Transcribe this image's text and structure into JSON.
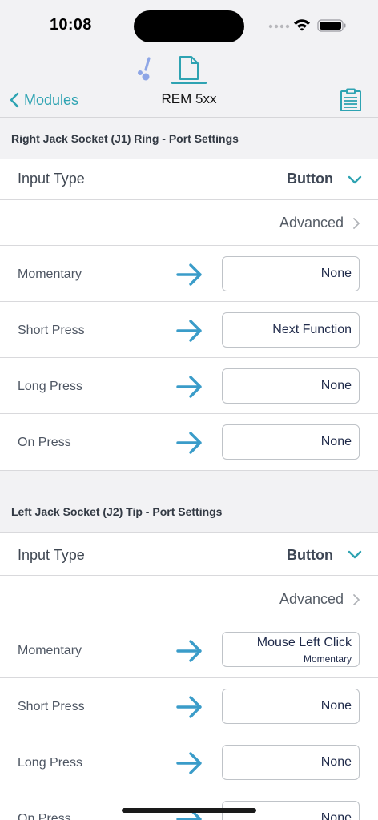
{
  "status_bar": {
    "time": "10:08"
  },
  "nav": {
    "back_label": "Modules",
    "title": "REM 5xx"
  },
  "colors": {
    "accent": "#2ea3b2",
    "arrow": "#3a9cc9",
    "wheelchair_icon": "#8ea6e6"
  },
  "sections": [
    {
      "header": "Right Jack Socket (J1) Ring - Port Settings",
      "input_type_label": "Input Type",
      "input_type_value": "Button",
      "advanced_label": "Advanced",
      "actions": [
        {
          "label": "Momentary",
          "value": "None",
          "sub": ""
        },
        {
          "label": "Short Press",
          "value": "Next Function",
          "sub": ""
        },
        {
          "label": "Long Press",
          "value": "None",
          "sub": ""
        },
        {
          "label": "On Press",
          "value": "None",
          "sub": ""
        }
      ]
    },
    {
      "header": "Left Jack Socket (J2) Tip - Port Settings",
      "input_type_label": "Input Type",
      "input_type_value": "Button",
      "advanced_label": "Advanced",
      "actions": [
        {
          "label": "Momentary",
          "value": "Mouse Left Click",
          "sub": "Momentary"
        },
        {
          "label": "Short Press",
          "value": "None",
          "sub": ""
        },
        {
          "label": "Long Press",
          "value": "None",
          "sub": ""
        },
        {
          "label": "On Press",
          "value": "None",
          "sub": ""
        }
      ]
    }
  ]
}
